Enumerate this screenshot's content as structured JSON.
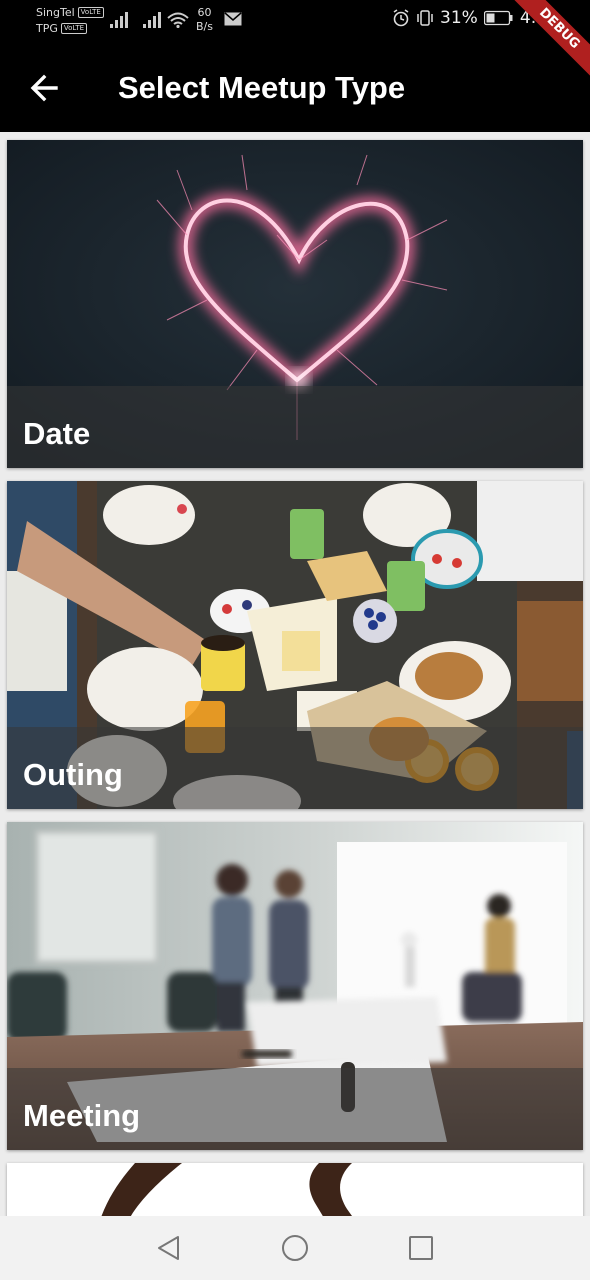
{
  "status_bar": {
    "carrier1": "SingTel",
    "carrier2": "TPG",
    "volte": "VoLTE",
    "net_speed_value": "60",
    "net_speed_unit": "B/s",
    "battery": "31%",
    "time": "4:58"
  },
  "debug_banner": "DEBUG",
  "app_bar": {
    "title": "Select Meetup Type"
  },
  "meetup_types": [
    {
      "label": "Date"
    },
    {
      "label": "Outing"
    },
    {
      "label": "Meeting"
    }
  ],
  "icons": {
    "back": "arrow-back-icon",
    "nav_back": "triangle-back-icon",
    "nav_home": "circle-home-icon",
    "nav_recent": "square-recent-icon"
  }
}
